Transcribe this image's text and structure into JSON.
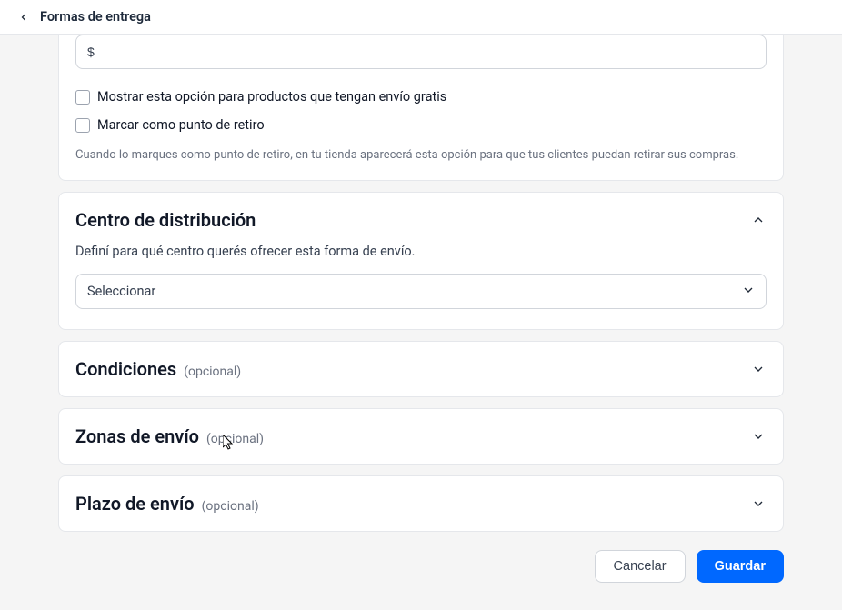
{
  "header": {
    "title": "Formas de entrega"
  },
  "top_card": {
    "currency_prefix": "$",
    "checkbox_free_shipping": "Mostrar esta opción para productos que tengan envío gratis",
    "checkbox_pickup_point": "Marcar como punto de retiro",
    "pickup_hint": "Cuando lo marques como punto de retiro, en tu tienda aparecerá esta opción para que tus clientes puedan retirar sus compras."
  },
  "distribution": {
    "title": "Centro de distribución",
    "description": "Definí para qué centro querés ofrecer esta forma de envío.",
    "select_placeholder": "Seleccionar"
  },
  "conditions": {
    "title": "Condiciones",
    "optional": "(opcional)"
  },
  "shipping_zones": {
    "title": "Zonas de envío",
    "optional": "(opcional)"
  },
  "shipping_time": {
    "title": "Plazo de envío",
    "optional": "(opcional)"
  },
  "footer": {
    "cancel": "Cancelar",
    "save": "Guardar"
  }
}
